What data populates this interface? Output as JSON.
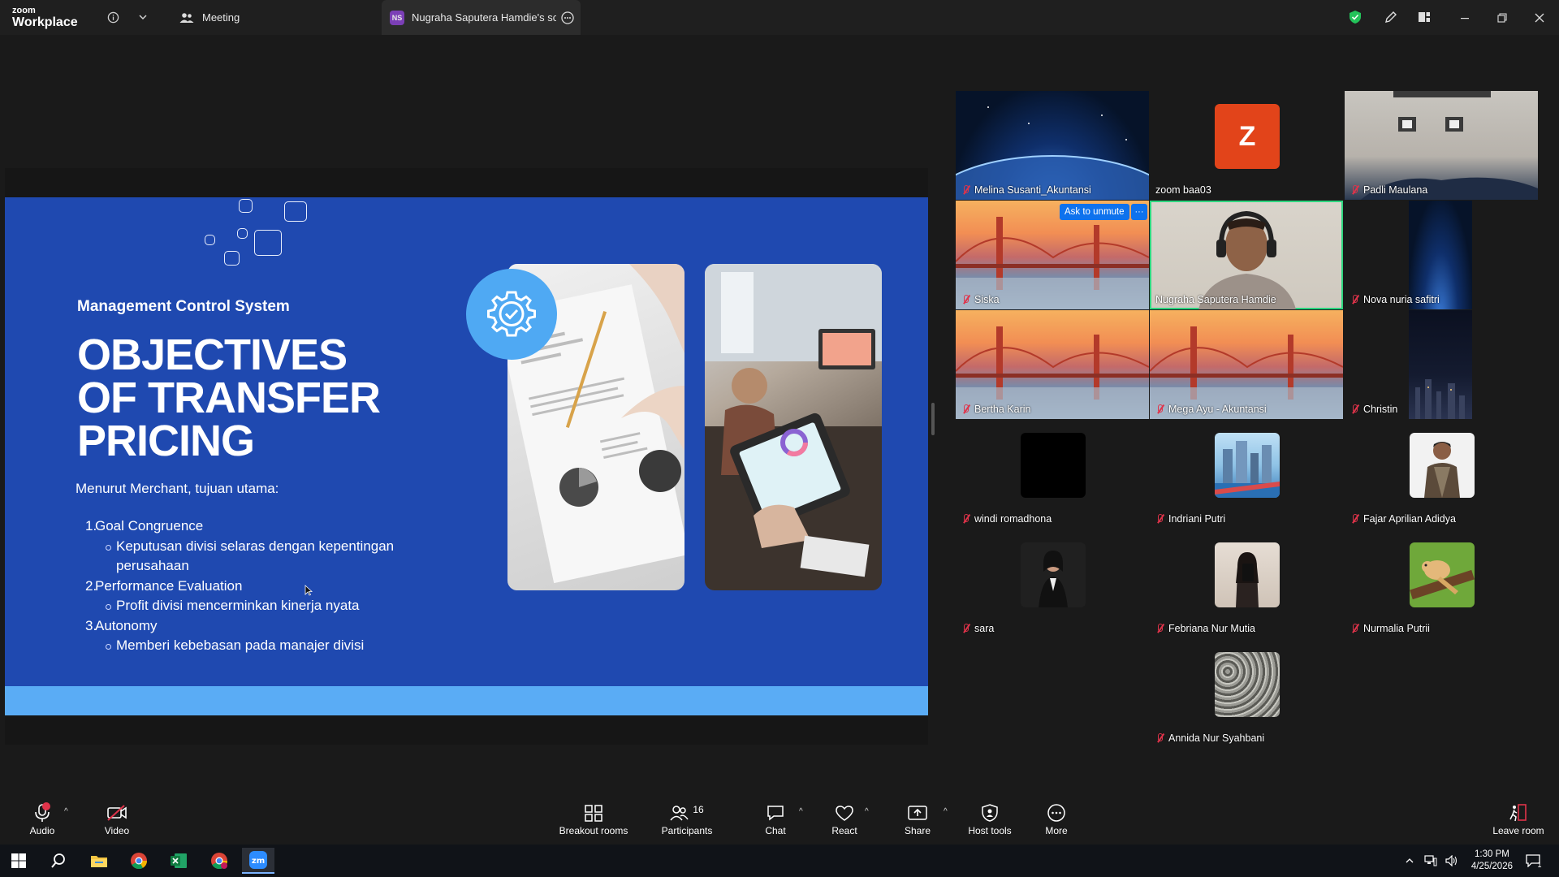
{
  "app": {
    "logo_line1": "zoom",
    "logo_line2": "Workplace",
    "meeting_tab": "Meeting",
    "share_tab_badge": "NS",
    "share_tab_label": "Nugraha Saputera Hamdie's scree"
  },
  "slide": {
    "subtitle": "Management Control System",
    "title_line1": "OBJECTIVES",
    "title_line2": "OF TRANSFER",
    "title_line3": "PRICING",
    "intro": "Menurut Merchant, tujuan utama:",
    "items": [
      {
        "num": "1.",
        "label": "Goal Congruence",
        "sub": "Keputusan divisi selaras dengan kepentingan perusahaan"
      },
      {
        "num": "2.",
        "label": "Performance Evaluation",
        "sub": "Profit divisi mencerminkan kinerja nyata"
      },
      {
        "num": "3.",
        "label": "Autonomy",
        "sub": "Memberi kebebasan pada manajer divisi"
      }
    ]
  },
  "participants": [
    {
      "name": "Melina Susanti_Akuntansi",
      "bg": "space"
    },
    {
      "name": "zoom baa03",
      "bg": "letter",
      "letter": "Z",
      "color": "#e2441a"
    },
    {
      "name": "Padli Maulana",
      "bg": "room"
    },
    {
      "name": "Siska",
      "bg": "bridge",
      "ask_to_unmute": "Ask to unmute"
    },
    {
      "name": "Nugraha Saputera Hamdie",
      "bg": "person"
    },
    {
      "name": "Nova nuria safitri",
      "bg": "space-narrow"
    },
    {
      "name": "Bertha Karin",
      "bg": "bridge"
    },
    {
      "name": "Mega Ayu - Akuntansi",
      "bg": "bridge"
    },
    {
      "name": "Christin",
      "bg": "night-narrow"
    },
    {
      "name": "windi romadhona",
      "bg": "black-avatar"
    },
    {
      "name": "Indriani Putri",
      "bg": "city-avatar"
    },
    {
      "name": "Fajar Aprilian Adidya",
      "bg": "man-avatar"
    },
    {
      "name": "sara",
      "bg": "woman-avatar"
    },
    {
      "name": "Febriana Nur Mutia",
      "bg": "selfie-avatar"
    },
    {
      "name": "Nurmalia Putrii",
      "bg": "cartoon-avatar"
    },
    {
      "name": "Annida Nur Syahbani",
      "bg": "gravel-avatar"
    }
  ],
  "toolbar": {
    "audio": "Audio",
    "video": "Video",
    "breakout": "Breakout rooms",
    "participants": "Participants",
    "participants_count": "16",
    "chat": "Chat",
    "react": "React",
    "share": "Share",
    "host_tools": "Host tools",
    "more": "More",
    "leave": "Leave room"
  },
  "taskbar": {
    "time": "1:30 PM",
    "date": "4/25/2026",
    "notification_count": "1"
  },
  "colors": {
    "slide_blue": "#1f49b0",
    "slide_bar": "#5aacf5",
    "zoom_blue": "#0e72ed",
    "mute_red": "#e0334a",
    "speaker_green": "#2ed67f"
  }
}
